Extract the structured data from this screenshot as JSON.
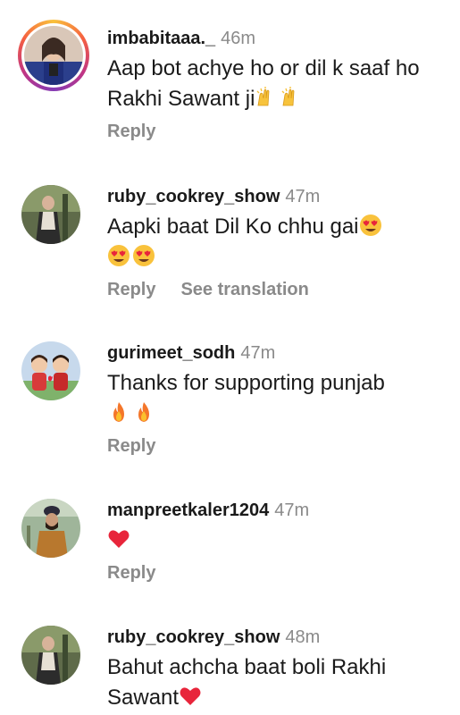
{
  "comments": [
    {
      "username": "imbabitaaa._",
      "time": "46m",
      "text": "Aap bot achye ho or dil k saaf ho Rakhi Sawant ji",
      "emojis": [
        "raising-hands",
        "raising-hands"
      ],
      "reply_label": "Reply",
      "has_story_ring": true
    },
    {
      "username": "ruby_cookrey_show",
      "time": "47m",
      "text": "Aapki baat Dil Ko chhu gai",
      "emojis": [
        "heart-eyes",
        "heart-eyes",
        "heart-eyes"
      ],
      "reply_label": "Reply",
      "see_translation_label": "See translation"
    },
    {
      "username": "gurimeet_sodh",
      "time": "47m",
      "text": "Thanks for supporting punjab",
      "emojis": [
        "fire",
        "fire"
      ],
      "reply_label": "Reply"
    },
    {
      "username": "manpreetkaler1204",
      "time": "47m",
      "text": "",
      "emojis": [
        "red-heart"
      ],
      "reply_label": "Reply"
    },
    {
      "username": "ruby_cookrey_show",
      "time": "48m",
      "text": "Bahut achcha baat boli Rakhi Sawant",
      "emojis": [
        "red-heart"
      ]
    }
  ]
}
